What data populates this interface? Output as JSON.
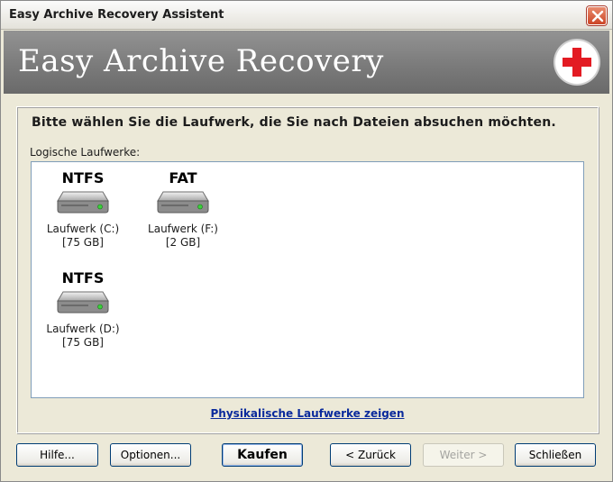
{
  "window": {
    "title": "Easy Archive Recovery Assistent"
  },
  "banner": {
    "brand": "Easy Archive Recovery"
  },
  "content": {
    "instruction": "Bitte wählen Sie die Laufwerk, die Sie nach Dateien absuchen möchten.",
    "list_label": "Logische Laufwerke:",
    "drives": [
      {
        "fs": "NTFS",
        "name": "Laufwerk (C:)",
        "size": "[75 GB]"
      },
      {
        "fs": "FAT",
        "name": "Laufwerk (F:)",
        "size": "[2 GB]"
      },
      {
        "fs": "NTFS",
        "name": "Laufwerk (D:)",
        "size": "[75 GB]"
      }
    ],
    "physical_link": "Physikalische Laufwerke zeigen"
  },
  "buttons": {
    "help": "Hilfe...",
    "options": "Optionen...",
    "buy": "Kaufen",
    "back": "< Zurück",
    "next": "Weiter >",
    "close": "Schließen"
  },
  "icons": {
    "close": "close-icon",
    "logo": "red-cross-icon",
    "drive": "hard-drive-icon"
  },
  "colors": {
    "banner": "#7b7b7b",
    "logo_cross": "#e31b23",
    "link": "#0a2a9c",
    "close_button": "#cc4526"
  }
}
